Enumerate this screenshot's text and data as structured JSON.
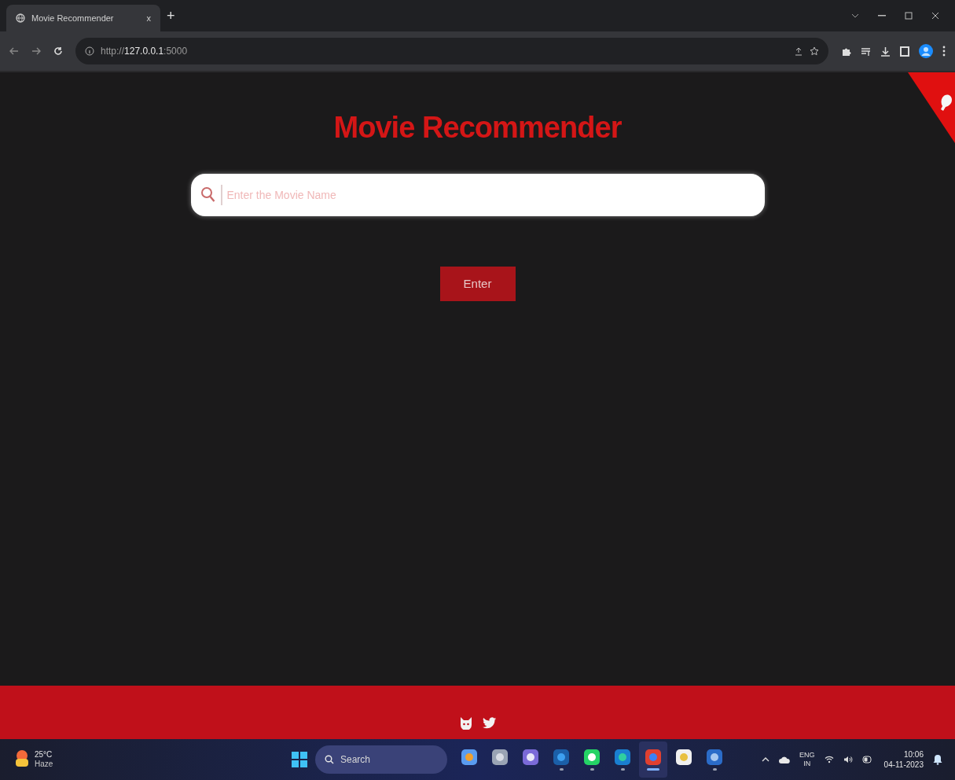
{
  "browser": {
    "tab": {
      "title": "Movie Recommender",
      "close": "x",
      "selected": true
    },
    "new_tab": "+",
    "address": {
      "scheme": "http://",
      "host": "127.0.0.1",
      "port": ":5000"
    }
  },
  "page": {
    "title": "Movie Recommender",
    "search": {
      "placeholder": "Enter the Movie Name"
    },
    "button": "Enter"
  },
  "taskbar": {
    "weather": {
      "temperature": "25°C",
      "condition": "Haze"
    },
    "search": "Search",
    "tray": {
      "language": "ENG",
      "region": "IN",
      "time": "10:06",
      "date": "04-11-2023"
    }
  }
}
